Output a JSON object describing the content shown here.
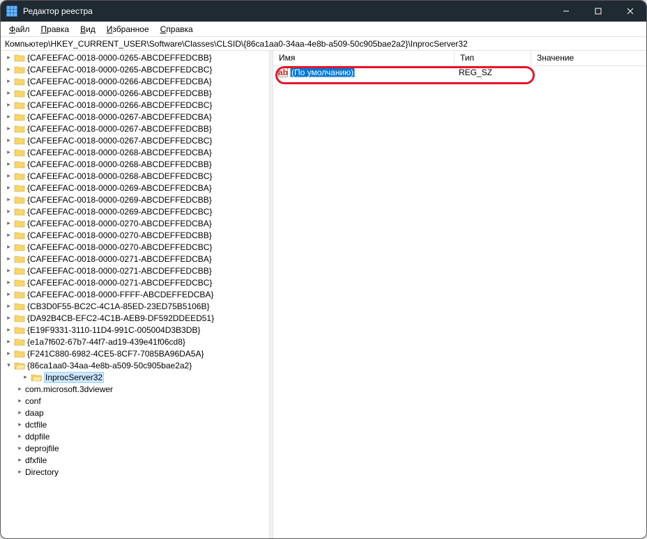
{
  "titlebar": {
    "title": "Редактор реестра"
  },
  "menubar": {
    "items": [
      {
        "underline": "Ф",
        "rest": "айл"
      },
      {
        "underline": "П",
        "rest": "равка"
      },
      {
        "underline": "В",
        "rest": "ид"
      },
      {
        "underline": "И",
        "rest": "збранное"
      },
      {
        "underline": "С",
        "rest": "правка"
      }
    ]
  },
  "addressbar": {
    "path": "Компьютер\\HKEY_CURRENT_USER\\Software\\Classes\\CLSID\\{86ca1aa0-34aa-4e8b-a509-50c905bae2a2}\\InprocServer32"
  },
  "tree": {
    "items": [
      {
        "label": "{CAFEEFAC-0018-0000-0265-ABCDEFFEDCBB}",
        "toggle": ">"
      },
      {
        "label": "{CAFEEFAC-0018-0000-0265-ABCDEFFEDCBC}",
        "toggle": ">"
      },
      {
        "label": "{CAFEEFAC-0018-0000-0266-ABCDEFFEDCBA}",
        "toggle": ">"
      },
      {
        "label": "{CAFEEFAC-0018-0000-0266-ABCDEFFEDCBB}",
        "toggle": ">"
      },
      {
        "label": "{CAFEEFAC-0018-0000-0266-ABCDEFFEDCBC}",
        "toggle": ">"
      },
      {
        "label": "{CAFEEFAC-0018-0000-0267-ABCDEFFEDCBA}",
        "toggle": ">"
      },
      {
        "label": "{CAFEEFAC-0018-0000-0267-ABCDEFFEDCBB}",
        "toggle": ">"
      },
      {
        "label": "{CAFEEFAC-0018-0000-0267-ABCDEFFEDCBC}",
        "toggle": ">"
      },
      {
        "label": "{CAFEEFAC-0018-0000-0268-ABCDEFFEDCBA}",
        "toggle": ">"
      },
      {
        "label": "{CAFEEFAC-0018-0000-0268-ABCDEFFEDCBB}",
        "toggle": ">"
      },
      {
        "label": "{CAFEEFAC-0018-0000-0268-ABCDEFFEDCBC}",
        "toggle": ">"
      },
      {
        "label": "{CAFEEFAC-0018-0000-0269-ABCDEFFEDCBA}",
        "toggle": ">"
      },
      {
        "label": "{CAFEEFAC-0018-0000-0269-ABCDEFFEDCBB}",
        "toggle": ">"
      },
      {
        "label": "{CAFEEFAC-0018-0000-0269-ABCDEFFEDCBC}",
        "toggle": ">"
      },
      {
        "label": "{CAFEEFAC-0018-0000-0270-ABCDEFFEDCBA}",
        "toggle": ">"
      },
      {
        "label": "{CAFEEFAC-0018-0000-0270-ABCDEFFEDCBB}",
        "toggle": ">"
      },
      {
        "label": "{CAFEEFAC-0018-0000-0270-ABCDEFFEDCBC}",
        "toggle": ">"
      },
      {
        "label": "{CAFEEFAC-0018-0000-0271-ABCDEFFEDCBA}",
        "toggle": ">"
      },
      {
        "label": "{CAFEEFAC-0018-0000-0271-ABCDEFFEDCBB}",
        "toggle": ">"
      },
      {
        "label": "{CAFEEFAC-0018-0000-0271-ABCDEFFEDCBC}",
        "toggle": ">"
      },
      {
        "label": "{CAFEEFAC-0018-0000-FFFF-ABCDEFFEDCBA}",
        "toggle": ">"
      },
      {
        "label": "{CB3D0F55-BC2C-4C1A-85ED-23ED75B5106B}",
        "toggle": ">"
      },
      {
        "label": "{DA92B4CB-EFC2-4C1B-AEB9-DF592DDEED51}",
        "toggle": ">"
      },
      {
        "label": "{E19F9331-3110-11D4-991C-005004D3B3DB}",
        "toggle": ">"
      },
      {
        "label": "{e1a7f602-67b7-44f7-ad19-439e41f06cd8}",
        "toggle": ">"
      },
      {
        "label": "{F241C880-6982-4CE5-8CF7-7085BA96DA5A}",
        "toggle": ">"
      },
      {
        "label": "{86ca1aa0-34aa-4e8b-a509-50c905bae2a2}",
        "toggle": "v",
        "open": true
      },
      {
        "label": "InprocServer32",
        "sub": true,
        "selected": true,
        "open": true
      },
      {
        "label": "com.microsoft.3dviewer",
        "nofolder": true
      },
      {
        "label": "conf",
        "nofolder": true
      },
      {
        "label": "daap",
        "nofolder": true
      },
      {
        "label": "dctfile",
        "nofolder": true
      },
      {
        "label": "ddpfile",
        "nofolder": true
      },
      {
        "label": "deprojfile",
        "nofolder": true
      },
      {
        "label": "dfxfile",
        "nofolder": true
      },
      {
        "label": "Directory",
        "nofolder": true
      }
    ]
  },
  "list": {
    "headers": {
      "name": "Имя",
      "type": "Тип",
      "data": "Значение"
    },
    "rows": [
      {
        "name": "(По умолчанию)",
        "type": "REG_SZ",
        "data": "",
        "selected": true
      }
    ]
  }
}
